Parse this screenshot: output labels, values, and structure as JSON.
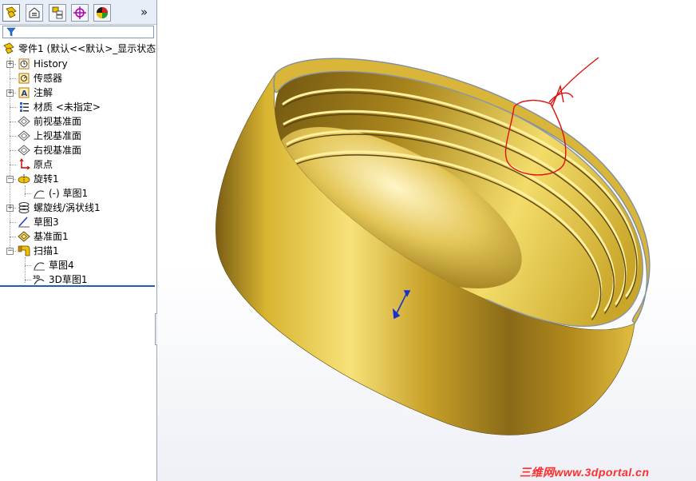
{
  "panel": {
    "tabs": [
      {
        "icon": "feature-manager-icon"
      },
      {
        "icon": "property-manager-icon"
      },
      {
        "icon": "configuration-manager-icon"
      },
      {
        "icon": "dimxpert-manager-icon"
      },
      {
        "icon": "display-manager-icon"
      }
    ],
    "more": "»",
    "filter_icon": "filter-icon"
  },
  "tree": {
    "root": "零件1  (默认<<默认>_显示状态",
    "items": [
      {
        "label": "History",
        "icon": "history-icon"
      },
      {
        "label": "传感器",
        "icon": "sensor-icon"
      },
      {
        "label": "注解",
        "icon": "annotation-icon"
      },
      {
        "label": "材质 <未指定>",
        "icon": "material-icon"
      },
      {
        "label": "前视基准面",
        "icon": "plane-icon"
      },
      {
        "label": "上视基准面",
        "icon": "plane-icon"
      },
      {
        "label": "右视基准面",
        "icon": "plane-icon"
      },
      {
        "label": "原点",
        "icon": "origin-icon"
      },
      {
        "label": "旋转1",
        "icon": "revolve-icon"
      },
      {
        "label": "(-) 草图1",
        "icon": "sketch-icon"
      },
      {
        "label": "螺旋线/涡状线1",
        "icon": "helix-icon"
      },
      {
        "label": "草图3",
        "icon": "sketch-icon"
      },
      {
        "label": "基准面1",
        "icon": "plane-icon"
      },
      {
        "label": "扫描1",
        "icon": "sweep-icon"
      },
      {
        "label": "草图4",
        "icon": "sketch-icon"
      },
      {
        "label": "3D草图1",
        "icon": "sketch3d-icon"
      }
    ]
  },
  "watermark": "三维网www.3dportal.cn",
  "colors": {
    "gold_light": "#f4d35e",
    "gold_dark": "#6b5312",
    "annotation_red": "#e01010",
    "selection_blue": "#1f5fb0"
  }
}
